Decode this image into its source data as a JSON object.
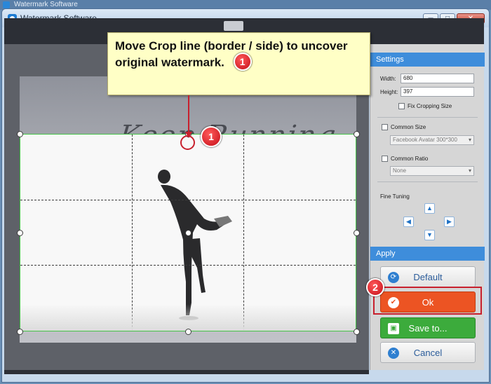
{
  "background_window": {
    "title": "Watermark Software"
  },
  "window": {
    "title": "Watermark Software",
    "controls": {
      "minimize": "─",
      "maximize": "□",
      "close": "✕"
    }
  },
  "canvas": {
    "watermark_text": "Keep Running"
  },
  "callout": {
    "text": "Move Crop line (border / side) to uncover original watermark.",
    "step1": "1",
    "step2": "2"
  },
  "settings": {
    "header": "Settings",
    "width_label": "Width:",
    "width_value": "680",
    "height_label": "Height:",
    "height_value": "397",
    "fix_cropping_label": "Fix Cropping Size",
    "common_size_label": "Common Size",
    "common_size_value": "Facebook Avatar 300*300",
    "common_ratio_label": "Common Ratio",
    "common_ratio_value": "None",
    "fine_tuning_label": "Fine Tuning"
  },
  "apply": {
    "header": "Apply",
    "default_label": "Default",
    "ok_label": "Ok",
    "save_label": "Save to...",
    "cancel_label": "Cancel"
  },
  "colors": {
    "accent_blue": "#3e8ddb",
    "ok_orange": "#ec5423",
    "save_green": "#3cab3c",
    "annotation_red": "#c8202d",
    "callout_yellow": "#ffffc6",
    "crop_border_green": "#46c349"
  },
  "icons": {
    "default": "refresh-icon",
    "ok": "check-icon",
    "save": "floppy-icon",
    "cancel": "close-icon"
  }
}
